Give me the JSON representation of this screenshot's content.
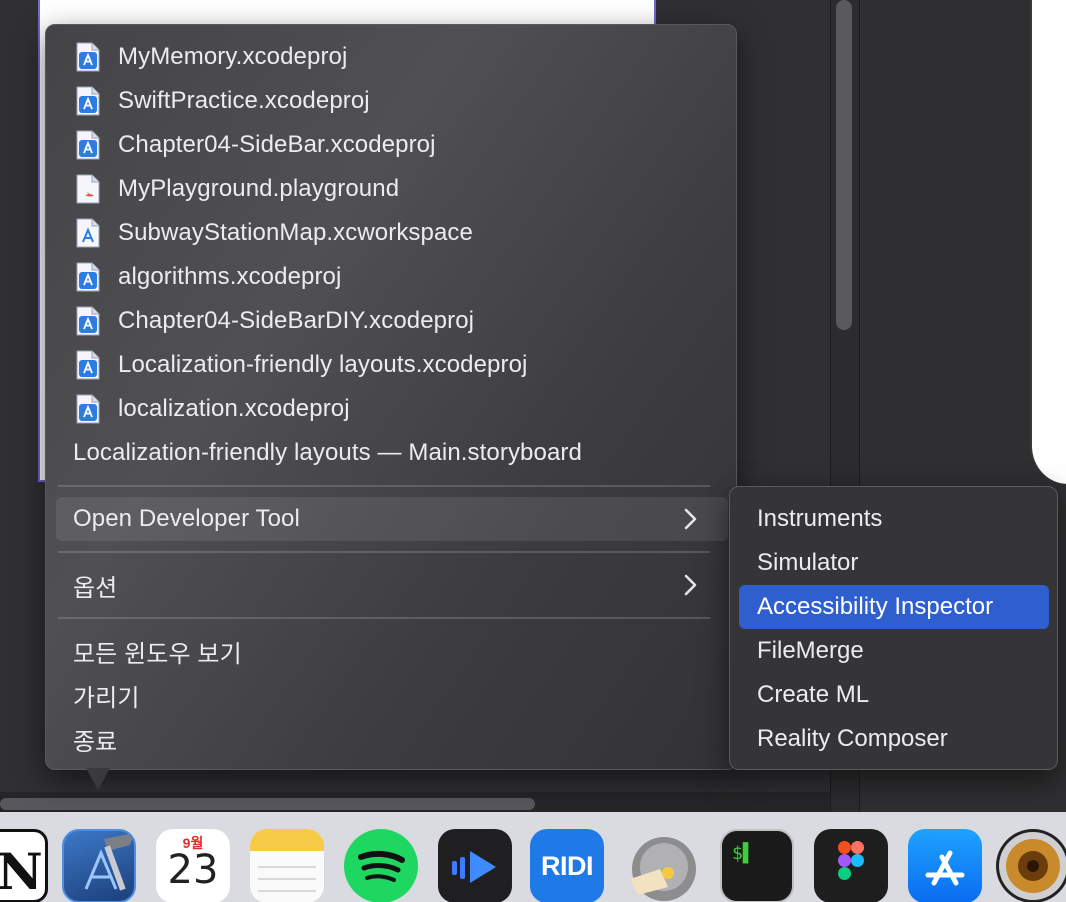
{
  "recent_items": [
    {
      "label": "MyMemory.xcodeproj",
      "icon": "xcodeproj-icon"
    },
    {
      "label": "SwiftPractice.xcodeproj",
      "icon": "xcodeproj-icon"
    },
    {
      "label": "Chapter04-SideBar.xcodeproj",
      "icon": "xcodeproj-icon"
    },
    {
      "label": "MyPlayground.playground",
      "icon": "playground-icon"
    },
    {
      "label": "SubwayStationMap.xcworkspace",
      "icon": "xcworkspace-icon"
    },
    {
      "label": "algorithms.xcodeproj",
      "icon": "xcodeproj-icon"
    },
    {
      "label": "Chapter04-SideBarDIY.xcodeproj",
      "icon": "xcodeproj-icon"
    },
    {
      "label": "Localization-friendly layouts.xcodeproj",
      "icon": "xcodeproj-icon"
    },
    {
      "label": "localization.xcodeproj",
      "icon": "xcodeproj-icon"
    },
    {
      "label": "Localization-friendly layouts — Main.storyboard"
    }
  ],
  "menu": {
    "open_developer_tool": "Open Developer Tool",
    "options": "옵션",
    "show_all_windows": "모든 윈도우 보기",
    "hide": "가리기",
    "quit": "종료"
  },
  "submenu": {
    "items": [
      {
        "label": "Instruments"
      },
      {
        "label": "Simulator"
      },
      {
        "label": "Accessibility Inspector",
        "selected": true
      },
      {
        "label": "FileMerge"
      },
      {
        "label": "Create ML"
      },
      {
        "label": "Reality Composer"
      }
    ]
  },
  "dock": {
    "notion_letter": "N",
    "calendar_month": "9월",
    "calendar_day": "23",
    "ridi_label": "RIDI",
    "terminal_prompt": "$▌",
    "apps": [
      "notion-icon",
      "xcode-icon",
      "calendar-icon",
      "notes-icon",
      "spotify-icon",
      "infuse-icon",
      "ridi-icon",
      "archive-utility-icon",
      "terminal-icon",
      "figma-icon",
      "app-store-icon",
      "speaker-icon"
    ]
  },
  "colors": {
    "selection": "#2f5fcf",
    "menu_text": "#ececee"
  }
}
